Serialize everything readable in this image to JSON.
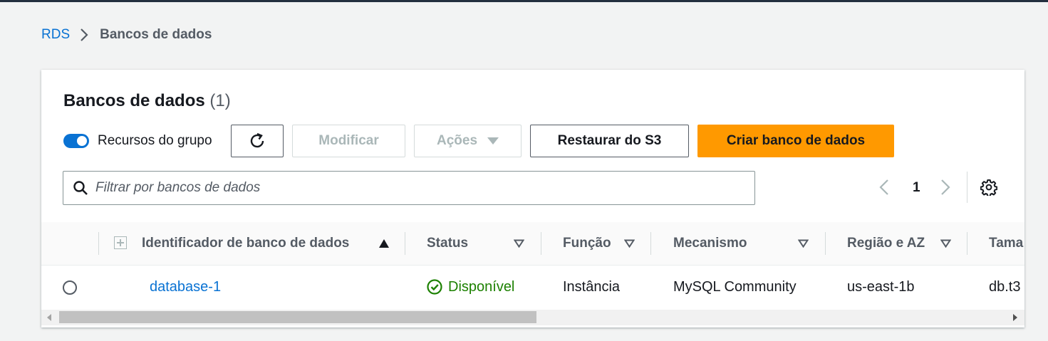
{
  "breadcrumb": {
    "root": "RDS",
    "current": "Bancos de dados"
  },
  "panel": {
    "title": "Bancos de dados",
    "count": "(1)"
  },
  "toolbar": {
    "group_toggle_label": "Recursos do grupo",
    "group_toggle_on": true,
    "modify_label": "Modificar",
    "actions_label": "Ações",
    "restore_label": "Restaurar do S3",
    "create_label": "Criar banco de dados"
  },
  "search": {
    "placeholder": "Filtrar por bancos de dados",
    "value": ""
  },
  "pagination": {
    "current_page": "1"
  },
  "table": {
    "columns": [
      "Identificador de banco de dados",
      "Status",
      "Função",
      "Mecanismo",
      "Região e AZ",
      "Tama"
    ],
    "rows": [
      {
        "identifier": "database-1",
        "status": "Disponível",
        "role": "Instância",
        "engine": "MySQL Community",
        "region_az": "us-east-1b",
        "size": "db.t3"
      }
    ]
  },
  "colors": {
    "primary_button": "#ff9900",
    "link": "#0972d3",
    "status_available": "#1d8102",
    "toggle_on": "#0972d3"
  }
}
